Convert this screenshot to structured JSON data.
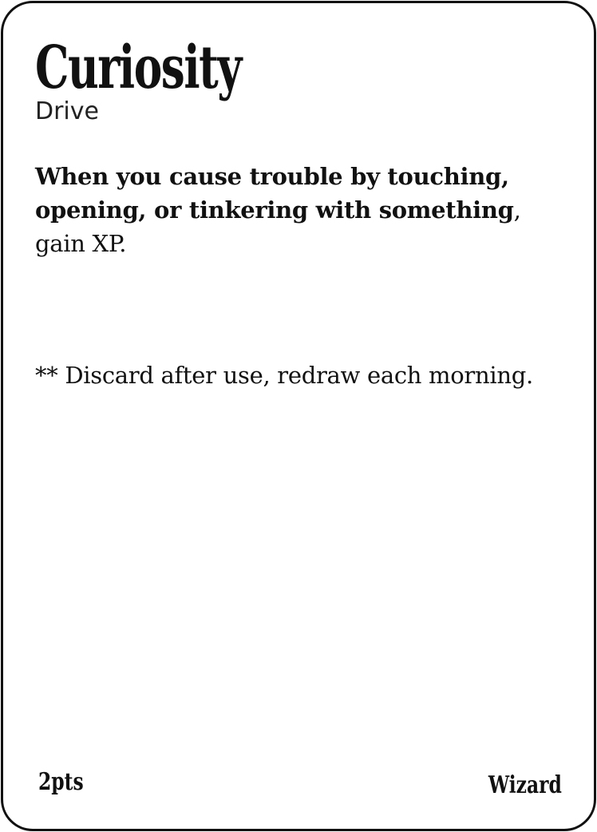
{
  "card": {
    "title": "Curiosity",
    "type": "Drive",
    "rules": {
      "trigger": "When you cause trouble by touching, opening, or tinkering with something",
      "effect": ", gain XP."
    },
    "note": "** Discard after use, redraw each morning.",
    "points": "2pts",
    "class": "Wizard"
  }
}
